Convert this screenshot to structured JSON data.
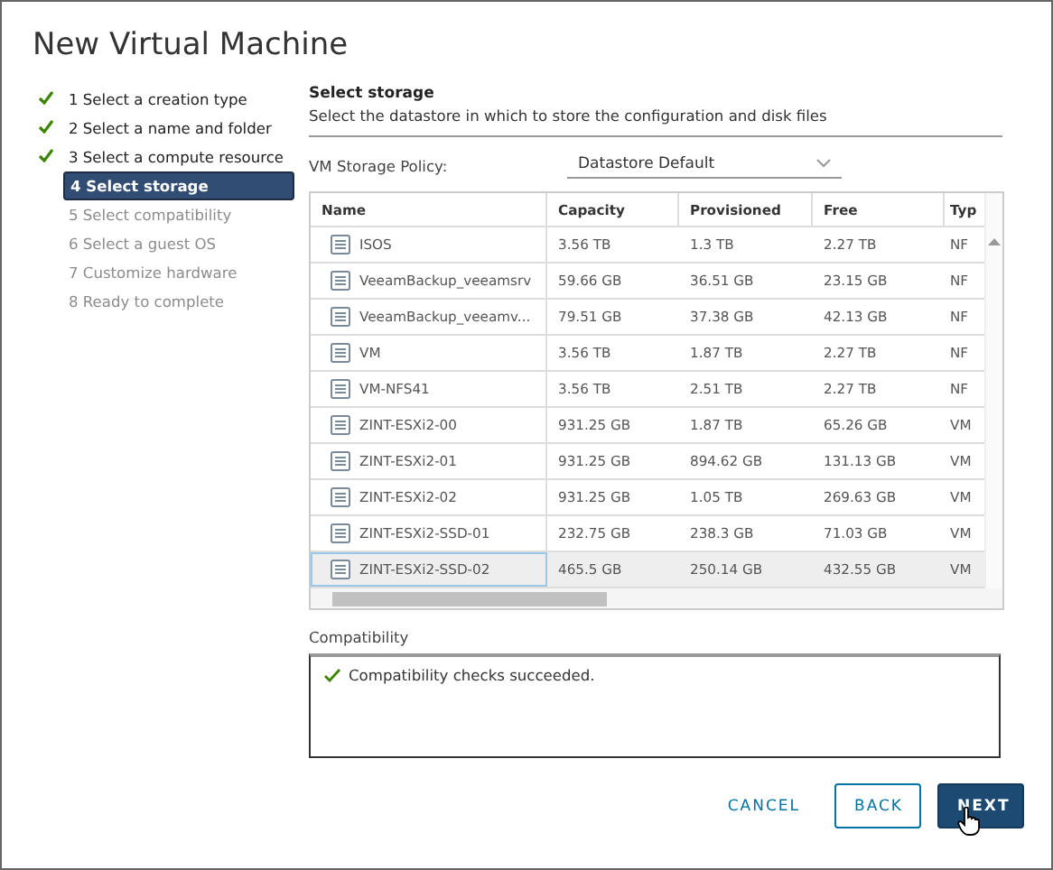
{
  "window": {
    "title": "New Virtual Machine"
  },
  "steps": [
    {
      "label": "1 Select a creation type",
      "completed": true,
      "selected": false,
      "disabled": false
    },
    {
      "label": "2 Select a name and folder",
      "completed": true,
      "selected": false,
      "disabled": false
    },
    {
      "label": "3 Select a compute resource",
      "completed": true,
      "selected": false,
      "disabled": false
    },
    {
      "label": "4 Select storage",
      "completed": false,
      "selected": true,
      "disabled": false
    },
    {
      "label": "5 Select compatibility",
      "completed": false,
      "selected": false,
      "disabled": true
    },
    {
      "label": "6 Select a guest OS",
      "completed": false,
      "selected": false,
      "disabled": true
    },
    {
      "label": "7 Customize hardware",
      "completed": false,
      "selected": false,
      "disabled": true
    },
    {
      "label": "8 Ready to complete",
      "completed": false,
      "selected": false,
      "disabled": true
    }
  ],
  "section": {
    "title": "Select storage",
    "description": "Select the datastore in which to store the configuration and disk files"
  },
  "policy": {
    "label": "VM Storage Policy:",
    "value": "Datastore Default"
  },
  "table": {
    "columns": [
      "Name",
      "Capacity",
      "Provisioned",
      "Free",
      "Typ"
    ],
    "rows": [
      {
        "cells": [
          "ISOS",
          "3.56 TB",
          "1.3 TB",
          "2.27 TB",
          "NF"
        ],
        "selected": false
      },
      {
        "cells": [
          "VeeamBackup_veeamsrv",
          "59.66 GB",
          "36.51 GB",
          "23.15 GB",
          "NF"
        ],
        "selected": false
      },
      {
        "cells": [
          "VeeamBackup_veeamv...",
          "79.51 GB",
          "37.38 GB",
          "42.13 GB",
          "NF"
        ],
        "selected": false
      },
      {
        "cells": [
          "VM",
          "3.56 TB",
          "1.87 TB",
          "2.27 TB",
          "NF"
        ],
        "selected": false
      },
      {
        "cells": [
          "VM-NFS41",
          "3.56 TB",
          "2.51 TB",
          "2.27 TB",
          "NF"
        ],
        "selected": false
      },
      {
        "cells": [
          "ZINT-ESXi2-00",
          "931.25 GB",
          "1.87 TB",
          "65.26 GB",
          "VM"
        ],
        "selected": false
      },
      {
        "cells": [
          "ZINT-ESXi2-01",
          "931.25 GB",
          "894.62 GB",
          "131.13 GB",
          "VM"
        ],
        "selected": false
      },
      {
        "cells": [
          "ZINT-ESXi2-02",
          "931.25 GB",
          "1.05 TB",
          "269.63 GB",
          "VM"
        ],
        "selected": false
      },
      {
        "cells": [
          "ZINT-ESXi2-SSD-01",
          "232.75 GB",
          "238.3 GB",
          "71.03 GB",
          "VM"
        ],
        "selected": false
      },
      {
        "cells": [
          "ZINT-ESXi2-SSD-02",
          "465.5 GB",
          "250.14 GB",
          "432.55 GB",
          "VM"
        ],
        "selected": true
      }
    ]
  },
  "compatibility": {
    "label": "Compatibility",
    "message": "Compatibility checks succeeded.",
    "success": true
  },
  "buttons": [
    {
      "label": "CANCEL",
      "kind": "flat"
    },
    {
      "label": "BACK",
      "kind": "outline"
    },
    {
      "label": "NEXT",
      "kind": "primary"
    }
  ]
}
